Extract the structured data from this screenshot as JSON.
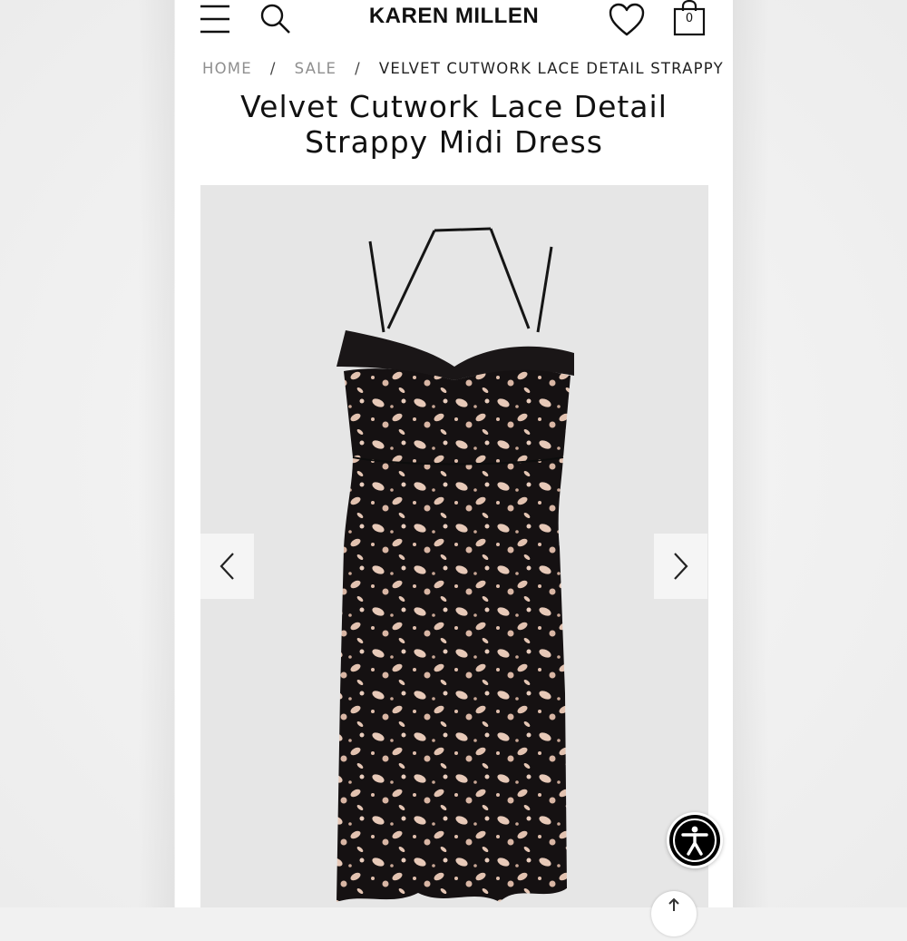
{
  "header": {
    "logo_text": "KAREN MILLEN",
    "menu_icon": "hamburger-menu-icon",
    "search_icon": "search-icon",
    "wishlist_icon": "heart-icon",
    "bag_icon": "shopping-bag-icon",
    "bag_count": "0"
  },
  "breadcrumb": {
    "items": [
      "HOME",
      "SALE",
      "VELVET CUTWORK LACE DETAIL STRAPPY"
    ],
    "separator": "/"
  },
  "product": {
    "title_line1": "Velvet Cutwork Lace Detail",
    "title_line2": "Strappy Midi Dress"
  },
  "gallery": {
    "prev_icon": "chevron-left-icon",
    "next_icon": "chevron-right-icon"
  },
  "floating": {
    "accessibility_icon": "accessibility-icon",
    "share_icon": "share-icon"
  },
  "colors": {
    "page_bg": "#ffffff",
    "gallery_bg": "#e6e6e6",
    "dress": "#111111",
    "lining": "#e9cbbb",
    "text": "#111111",
    "breadcrumb": "#8a8a8a"
  }
}
